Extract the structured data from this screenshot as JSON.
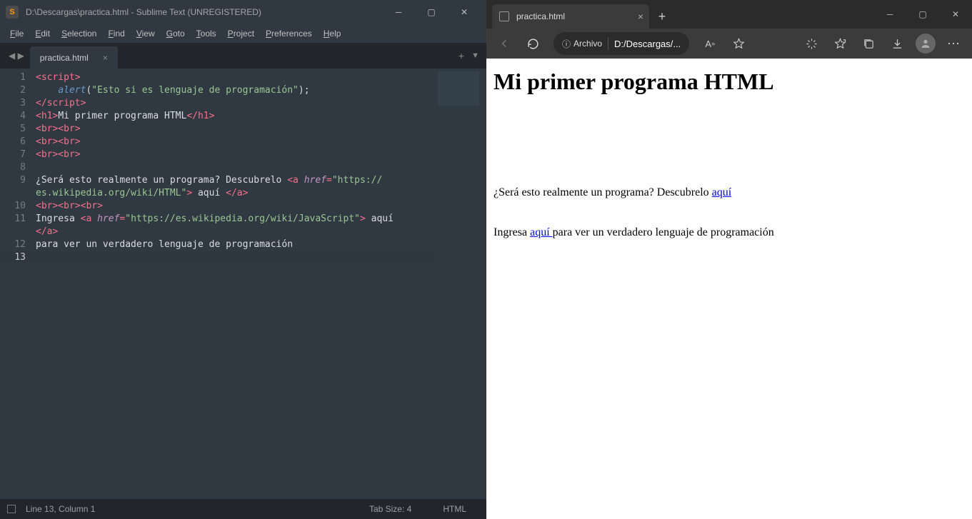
{
  "sublime": {
    "title": "D:\\Descargas\\practica.html - Sublime Text (UNREGISTERED)",
    "logo_char": "S",
    "menubar": [
      "File",
      "Edit",
      "Selection",
      "Find",
      "View",
      "Goto",
      "Tools",
      "Project",
      "Preferences",
      "Help"
    ],
    "tab_name": "practica.html",
    "code_lines": [
      {
        "n": "1",
        "segments": [
          {
            "t": "<",
            "c": "c-op"
          },
          {
            "t": "script",
            "c": "c-tag"
          },
          {
            "t": ">",
            "c": "c-op"
          }
        ]
      },
      {
        "n": "2",
        "segments": [
          {
            "t": "    ",
            "c": "c-txt"
          },
          {
            "t": "alert",
            "c": "c-fn"
          },
          {
            "t": "(",
            "c": "c-txt"
          },
          {
            "t": "\"Esto si es lenguaje de programación\"",
            "c": "c-str"
          },
          {
            "t": ");",
            "c": "c-txt"
          }
        ]
      },
      {
        "n": "3",
        "segments": [
          {
            "t": "</",
            "c": "c-op"
          },
          {
            "t": "script",
            "c": "c-tag"
          },
          {
            "t": ">",
            "c": "c-op"
          }
        ]
      },
      {
        "n": "4",
        "segments": [
          {
            "t": "<",
            "c": "c-op"
          },
          {
            "t": "h1",
            "c": "c-tag"
          },
          {
            "t": ">",
            "c": "c-op"
          },
          {
            "t": "Mi primer programa HTML",
            "c": "c-txt"
          },
          {
            "t": "</",
            "c": "c-op"
          },
          {
            "t": "h1",
            "c": "c-tag"
          },
          {
            "t": ">",
            "c": "c-op"
          }
        ]
      },
      {
        "n": "5",
        "segments": [
          {
            "t": "<",
            "c": "c-op"
          },
          {
            "t": "br",
            "c": "c-tag"
          },
          {
            "t": "><",
            "c": "c-op"
          },
          {
            "t": "br",
            "c": "c-tag"
          },
          {
            "t": ">",
            "c": "c-op"
          }
        ]
      },
      {
        "n": "6",
        "segments": [
          {
            "t": "<",
            "c": "c-op"
          },
          {
            "t": "br",
            "c": "c-tag"
          },
          {
            "t": "><",
            "c": "c-op"
          },
          {
            "t": "br",
            "c": "c-tag"
          },
          {
            "t": ">",
            "c": "c-op"
          }
        ]
      },
      {
        "n": "7",
        "segments": [
          {
            "t": "<",
            "c": "c-op"
          },
          {
            "t": "br",
            "c": "c-tag"
          },
          {
            "t": "><",
            "c": "c-op"
          },
          {
            "t": "br",
            "c": "c-tag"
          },
          {
            "t": ">",
            "c": "c-op"
          }
        ]
      },
      {
        "n": "8",
        "segments": []
      },
      {
        "n": "9",
        "segments": [
          {
            "t": "¿Será esto realmente un programa? Descubrelo ",
            "c": "c-txt"
          },
          {
            "t": "<",
            "c": "c-op"
          },
          {
            "t": "a",
            "c": "c-tag"
          },
          {
            "t": " ",
            "c": "c-txt"
          },
          {
            "t": "href",
            "c": "c-attr"
          },
          {
            "t": "=",
            "c": "c-op"
          },
          {
            "t": "\"https://",
            "c": "c-str"
          }
        ]
      },
      {
        "n": "",
        "wrap": true,
        "segments": [
          {
            "t": "es.wikipedia.org/wiki/HTML\"",
            "c": "c-str"
          },
          {
            "t": ">",
            "c": "c-op"
          },
          {
            "t": " aquí ",
            "c": "c-txt"
          },
          {
            "t": "</",
            "c": "c-op"
          },
          {
            "t": "a",
            "c": "c-tag"
          },
          {
            "t": ">",
            "c": "c-op"
          }
        ]
      },
      {
        "n": "10",
        "segments": [
          {
            "t": "<",
            "c": "c-op"
          },
          {
            "t": "br",
            "c": "c-tag"
          },
          {
            "t": "><",
            "c": "c-op"
          },
          {
            "t": "br",
            "c": "c-tag"
          },
          {
            "t": "><",
            "c": "c-op"
          },
          {
            "t": "br",
            "c": "c-tag"
          },
          {
            "t": ">",
            "c": "c-op"
          }
        ]
      },
      {
        "n": "11",
        "segments": [
          {
            "t": "Ingresa ",
            "c": "c-txt"
          },
          {
            "t": "<",
            "c": "c-op"
          },
          {
            "t": "a",
            "c": "c-tag"
          },
          {
            "t": " ",
            "c": "c-txt"
          },
          {
            "t": "href",
            "c": "c-attr"
          },
          {
            "t": "=",
            "c": "c-op"
          },
          {
            "t": "\"https://es.wikipedia.org/wiki/JavaScript\"",
            "c": "c-str"
          },
          {
            "t": ">",
            "c": "c-op"
          },
          {
            "t": " aquí ",
            "c": "c-txt"
          }
        ]
      },
      {
        "n": "",
        "wrap": true,
        "segments": [
          {
            "t": "</",
            "c": "c-op"
          },
          {
            "t": "a",
            "c": "c-tag"
          },
          {
            "t": ">",
            "c": "c-op"
          }
        ]
      },
      {
        "n": "12",
        "segments": [
          {
            "t": "para ver un verdadero lenguaje de programación",
            "c": "c-txt"
          }
        ]
      },
      {
        "n": "13",
        "cur": true,
        "segments": []
      }
    ],
    "status": {
      "pos": "Line 13, Column 1",
      "tabsize": "Tab Size: 4",
      "syntax": "HTML"
    }
  },
  "edge": {
    "tab_title": "practica.html",
    "url_label_prefix": "Archivo",
    "url_text": "D:/Descargas/...",
    "page": {
      "h1": "Mi primer programa HTML",
      "p1_before": "¿Será esto realmente un programa? Descubrelo ",
      "p1_link": "aquí",
      "p2_before": "Ingresa ",
      "p2_link": "aquí ",
      "p2_after": "para ver un verdadero lenguaje de programación"
    }
  }
}
